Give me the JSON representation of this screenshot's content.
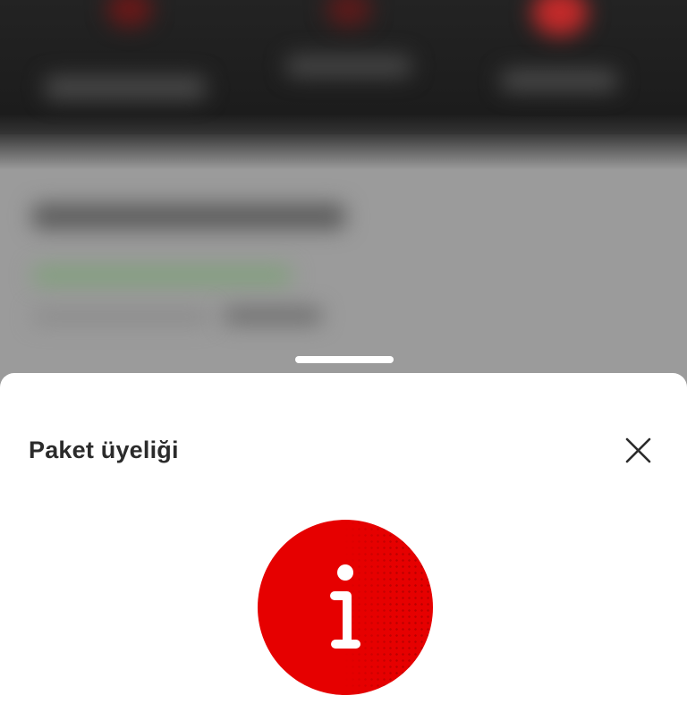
{
  "sheet": {
    "title": "Paket üyeliği"
  },
  "icons": {
    "close": "close-icon",
    "info": "info-icon"
  },
  "colors": {
    "accent": "#e60000",
    "title_text": "#2b2b2b",
    "sheet_background": "#ffffff",
    "backdrop": "#9b9b9b",
    "header_background": "#1f1f1f"
  }
}
